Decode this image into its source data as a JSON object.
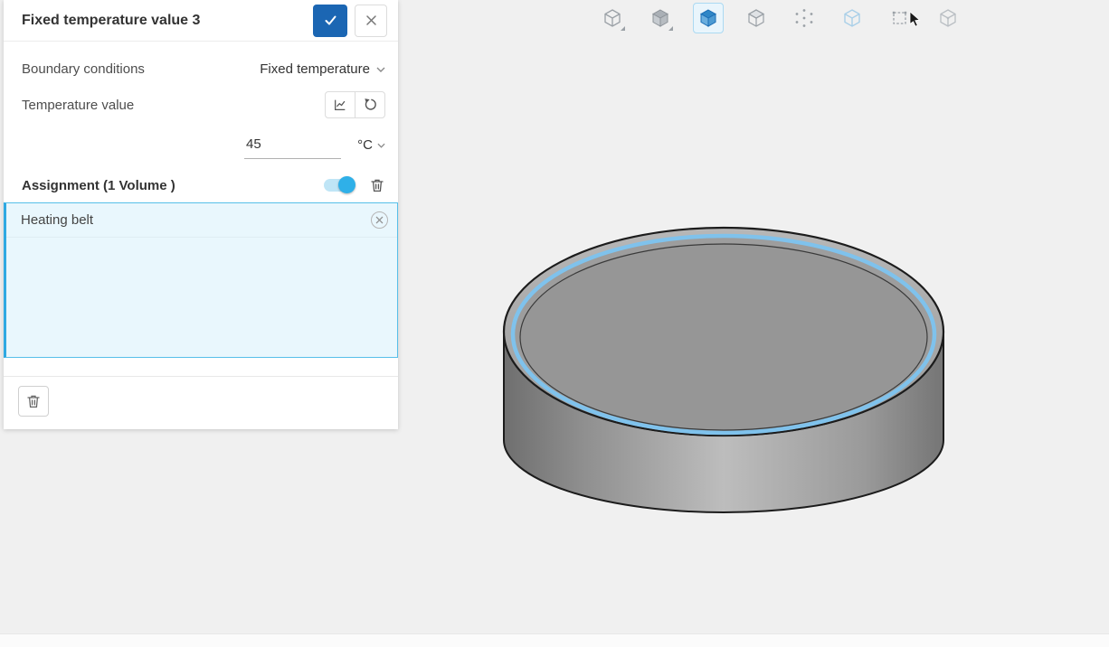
{
  "colors": {
    "accent": "#1b66b3",
    "toggle_on": "#2fb0e8",
    "selection_border": "#57bfe9",
    "selection_bg": "#e9f7fd",
    "highlight_ring": "#7fc2ec",
    "viewport_bg": "#f0f0f0"
  },
  "panel": {
    "title": "Fixed temperature value 3",
    "rows": {
      "boundary": {
        "label": "Boundary conditions",
        "value": "Fixed temperature"
      },
      "temperature": {
        "label": "Temperature value",
        "value": "45",
        "unit": "°C"
      }
    },
    "assignment": {
      "label": "Assignment (1 Volume )",
      "toggle_on": true,
      "items": [
        {
          "name": "Heating belt"
        }
      ]
    }
  },
  "toolbar": {
    "icons": [
      {
        "name": "geometry-cube-icon",
        "active": false
      },
      {
        "name": "solid-cube-icon",
        "active": false
      },
      {
        "name": "volume-select-cube-icon",
        "active": true
      },
      {
        "name": "face-select-cube-icon",
        "active": false
      },
      {
        "name": "vertex-select-cube-icon",
        "active": false
      },
      {
        "name": "edge-select-cube-icon",
        "active": false
      },
      {
        "name": "box-select-icon",
        "active": false
      },
      {
        "name": "hidden-geometry-cube-icon",
        "active": false
      }
    ]
  }
}
